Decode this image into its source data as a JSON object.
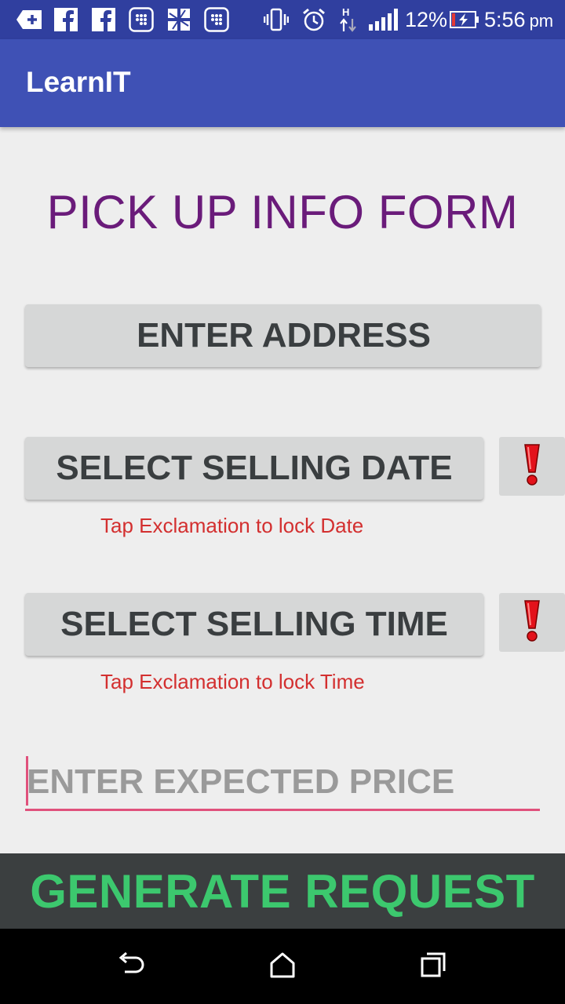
{
  "status_bar": {
    "signal_label": "H",
    "battery_percent": "12%",
    "time": "5:56",
    "ampm": "pm",
    "icons": [
      "add-box-icon",
      "facebook-icon",
      "facebook-icon",
      "app-grid-icon",
      "puzzle-icon",
      "app-grid-icon",
      "vibrate-icon",
      "alarm-icon",
      "data-transfer-icon",
      "signal-strength-icon",
      "battery-charging-icon"
    ]
  },
  "app_bar": {
    "title": "LearnIT"
  },
  "form": {
    "title": "PICK UP INFO FORM",
    "address_button": "ENTER ADDRESS",
    "date_button": "SELECT SELLING DATE",
    "date_hint": "Tap Exclamation to lock Date",
    "time_button": "SELECT SELLING TIME",
    "time_hint": "Tap Exclamation to lock Time",
    "price_placeholder": "ENTER EXPECTED PRICE",
    "price_value": "",
    "lock_icon": "exclamation-icon"
  },
  "generate_button": "GENERATE REQUEST",
  "nav_bar": {
    "icons": [
      "back-icon",
      "home-icon",
      "recents-icon"
    ]
  },
  "colors": {
    "status_bar": "#303f9f",
    "app_bar": "#3f51b5",
    "title": "#6a1b7a",
    "hint": "#d32f2f",
    "underline": "#e0517c",
    "generate_text": "#3cc86e",
    "generate_bg": "#3b3f40"
  }
}
